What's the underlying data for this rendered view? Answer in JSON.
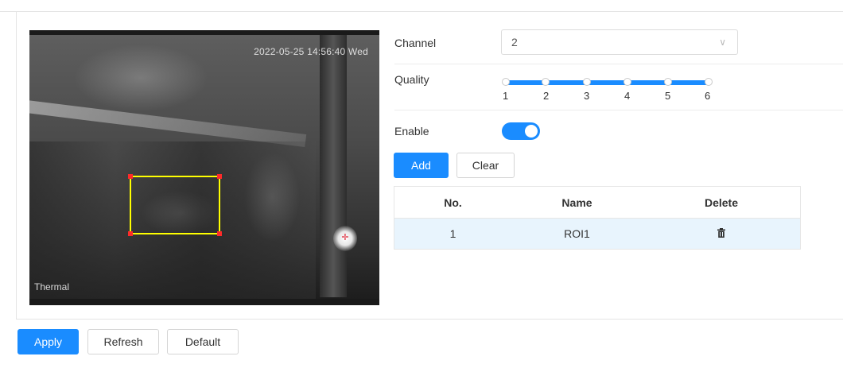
{
  "video": {
    "timestamp": "2022-05-25 14:56:40 Wed",
    "channel_label": "Thermal"
  },
  "form": {
    "channel": {
      "label": "Channel",
      "value": "2"
    },
    "quality": {
      "label": "Quality",
      "ticks": [
        "1",
        "2",
        "3",
        "4",
        "5",
        "6"
      ],
      "selected": "6"
    },
    "enable": {
      "label": "Enable",
      "on": true
    }
  },
  "actions": {
    "add": "Add",
    "clear": "Clear"
  },
  "table": {
    "headers": {
      "no": "No.",
      "name": "Name",
      "delete": "Delete"
    },
    "rows": [
      {
        "no": "1",
        "name": "ROI1"
      }
    ]
  },
  "footer": {
    "apply": "Apply",
    "refresh": "Refresh",
    "default": "Default"
  },
  "colors": {
    "accent": "#1a8cff",
    "roi_border": "#ffff00",
    "roi_handle": "#ff2a2a",
    "row_highlight": "#e8f4fd"
  }
}
